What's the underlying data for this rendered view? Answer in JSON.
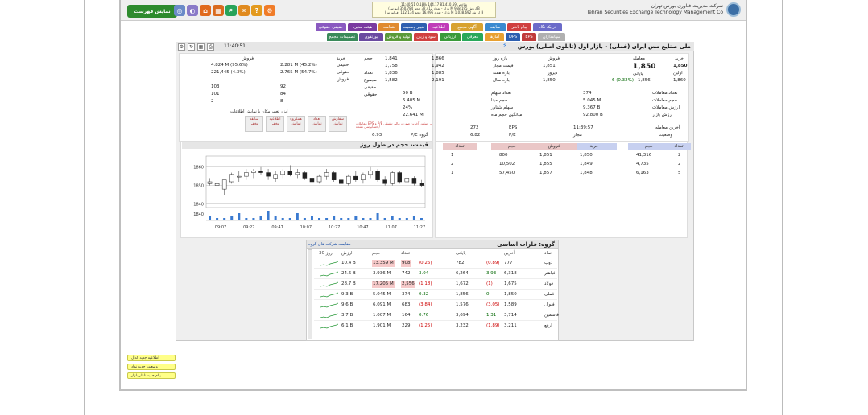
{
  "header": {
    "show_list_label": "نمایش فهرست",
    "brand_fa": "شرکت مدیریت فناوری بورس تهران",
    "brand_en": "Tehran Securities Exchange Technology Management Co",
    "index_lines": [
      "11:40:51 شاخص 81,410.59 144.17 %0.18",
      "(بورس) بازار - تعداد 32,412 حجم 350.784 M ارزش 958.195 B",
      "(فرابورس) بازار - تعداد 16,096 حجم 112.174 M ارزش 1,038.692 B"
    ],
    "icons": [
      {
        "name": "gear-icon",
        "color": "#f07c28"
      },
      {
        "name": "help-icon",
        "color": "#e39a1e"
      },
      {
        "name": "chat-icon",
        "color": "#e08a1e"
      },
      {
        "name": "search-icon",
        "color": "#27a35a"
      },
      {
        "name": "calc-icon",
        "color": "#d96a1e"
      },
      {
        "name": "home-icon",
        "color": "#e06a1e"
      },
      {
        "name": "contrast-icon",
        "color": "#8a7ac8"
      },
      {
        "name": "globe-icon",
        "color": "#6a8ac8"
      }
    ]
  },
  "tabs_row1": [
    {
      "label": "در یک نگاه",
      "color": "#6b6bc9"
    },
    {
      "label": "پیام ناظر",
      "color": "#d04040"
    },
    {
      "label": "سابقه",
      "color": "#3a8ad0"
    },
    {
      "label": "آگهی مجمع",
      "color": "#d8a230"
    },
    {
      "label": "اطلاعیه",
      "color": "#c03bb8"
    },
    {
      "label": "تغییر وضعیت",
      "color": "#2f5fb0"
    },
    {
      "label": "شناسه",
      "color": "#e08a30"
    },
    {
      "label": "هیئت مدیره",
      "color": "#7a3aa0"
    },
    {
      "label": "حقیقی-حقوقی",
      "color": "#8a5ac0"
    }
  ],
  "tabs_row2": [
    {
      "label": "سهامداران",
      "color": "#b0b0b0"
    },
    {
      "label": "EPS",
      "color": "#c03b3b"
    },
    {
      "label": "DPS",
      "color": "#2d5fb0"
    },
    {
      "label": "آمارها",
      "color": "#e8a030"
    },
    {
      "label": "معرفی",
      "color": "#28a85a"
    },
    {
      "label": "ارزیابی",
      "color": "#3a9a3a"
    },
    {
      "label": "سود و زیان",
      "color": "#d04040"
    },
    {
      "label": "تولید و فروش",
      "color": "#5a9a3a"
    },
    {
      "label": "پورتفوی",
      "color": "#6a4aa0"
    },
    {
      "label": "تصمیمات مجمع",
      "color": "#3a8a5a"
    }
  ],
  "title": {
    "text": "ملی صنایع مس ایران (فملی) - بازار اول (تابلوی اصلی) بورس",
    "time": "11:40:51"
  },
  "price_panel": {
    "rows": [
      {
        "l1": "معامله",
        "v1": "",
        "l2": "فروش",
        "v2": "1,851",
        "l3": "خرید",
        "v3": "1,850"
      },
      {
        "l1": "",
        "v1": "1,850",
        "l2": "قیمت مجاز",
        "v2": "",
        "l3": "",
        "v3": ""
      },
      {
        "l1": "پایانی",
        "v1": "1,856",
        "l2": "دیروز",
        "v2": "1,850",
        "l3": "اولین",
        "v3": "1,860"
      }
    ],
    "final_change": "6 (0.32%)",
    "range": [
      {
        "label": "بازه روز",
        "a": "1,866",
        "b": "1,841"
      },
      {
        "label": "قیمت مجاز",
        "a": "1,942",
        "b": "1,758"
      },
      {
        "label": "بازه هفته",
        "a": "1,885",
        "b": "1,836"
      },
      {
        "label": "بازه سال",
        "a": "2,191",
        "b": "1,582"
      }
    ],
    "stats": [
      {
        "label": "تعداد معاملات",
        "value": "374"
      },
      {
        "label": "حجم معاملات",
        "value": "5.045 M"
      },
      {
        "label": "ارزش معاملات",
        "value": "9.367 B"
      },
      {
        "label": "ارزش بازار",
        "value": "92,800 B"
      }
    ],
    "stats2": [
      {
        "label": "تعداد سهام",
        "value": "50 B"
      },
      {
        "label": "حجم مبنا",
        "value": "5.405 M"
      },
      {
        "label": "سهام شناور",
        "value": "24%"
      },
      {
        "label": "میانگین حجم ماه",
        "value": "22.641 M"
      }
    ],
    "last_trade": {
      "label": "آخرین معامله",
      "value": "11:39:57"
    },
    "status": {
      "label": "وضعیت",
      "value": "مجاز"
    },
    "eps": {
      "label": "EPS",
      "value": "272"
    },
    "pe": {
      "label": "P/E",
      "value": "6.82"
    },
    "group_pe": {
      "label": "P/E گروه",
      "value": "6.93"
    },
    "warning": "معاملات EPS و P/E بر اساس آخرین صورت مالی تلفیقی / حسابرسی نشده"
  },
  "realleg": {
    "headers": [
      "خرید",
      "فروش"
    ],
    "rows": [
      {
        "label": "حجم",
        "buy": "2.281 M (45.2%)",
        "sell": "4.824 M (95.6%)",
        "t": "حقیقی"
      },
      {
        "label": "",
        "buy": "2.765 M (54.7%)",
        "sell": "221,445 (4.3%)",
        "t": "حقوقی"
      },
      {
        "label": "تعداد",
        "buy": "",
        "sell": "",
        "t": "فروش"
      },
      {
        "label": "مجموع",
        "buy": "92",
        "sell": "103",
        "t": ""
      },
      {
        "label": "حقیقی",
        "buy": "84",
        "sell": "101",
        "t": ""
      },
      {
        "label": "حقوقی",
        "buy": "8",
        "sell": "2",
        "t": ""
      }
    ],
    "note": "ابزار تغییر مکان یا نمایش اطلاعات",
    "buttons": [
      "سفارش نمایش",
      "تعداد نمایش",
      "همگروه نمایش",
      "اطلاعیه مخفی",
      "سابقه مخفی"
    ]
  },
  "orderbook": {
    "headers": [
      "تعداد",
      "حجم",
      "خرید",
      "فروش",
      "حجم",
      "تعداد"
    ],
    "rows": [
      {
        "c1": "2",
        "v1": "41,316",
        "p1": "1,850",
        "p2": "1,851",
        "v2": "800",
        "c2": "1"
      },
      {
        "c1": "2",
        "v1": "4,735",
        "p1": "1,849",
        "p2": "1,855",
        "v2": "10,502",
        "c2": "2"
      },
      {
        "c1": "5",
        "v1": "6,163",
        "p1": "1,848",
        "p2": "1,857",
        "v2": "57,450",
        "c2": "1"
      }
    ]
  },
  "chart_data": {
    "type": "candlestick",
    "title": "قیمت، حجم در طول روز",
    "x_ticks": [
      "09:07",
      "09:27",
      "09:47",
      "10:07",
      "10:27",
      "10:47",
      "11:07",
      "11:27"
    ],
    "y_ticks": [
      1860,
      1850,
      1840
    ],
    "ylim": [
      1838,
      1866
    ],
    "candles": [
      [
        1851,
        1854,
        1850,
        1852
      ],
      [
        1850,
        1849,
        1846,
        1851
      ],
      [
        1848,
        1853,
        1845,
        1853
      ],
      [
        1852,
        1857,
        1851,
        1856
      ],
      [
        1855,
        1858,
        1852,
        1855
      ],
      [
        1855,
        1859,
        1853,
        1857
      ],
      [
        1857,
        1859,
        1854,
        1858
      ],
      [
        1858,
        1860,
        1856,
        1857
      ],
      [
        1857,
        1859,
        1853,
        1855
      ],
      [
        1854,
        1858,
        1852,
        1856
      ],
      [
        1856,
        1859,
        1854,
        1858
      ],
      [
        1858,
        1861,
        1855,
        1856
      ],
      [
        1856,
        1859,
        1854,
        1857
      ],
      [
        1857,
        1858,
        1853,
        1854
      ],
      [
        1854,
        1856,
        1850,
        1852
      ],
      [
        1852,
        1856,
        1851,
        1855
      ],
      [
        1855,
        1859,
        1853,
        1857
      ],
      [
        1857,
        1858,
        1852,
        1853
      ],
      [
        1853,
        1855,
        1849,
        1851
      ],
      [
        1851,
        1856,
        1850,
        1855
      ],
      [
        1855,
        1858,
        1852,
        1853
      ],
      [
        1853,
        1857,
        1851,
        1856
      ],
      [
        1856,
        1860,
        1854,
        1858
      ],
      [
        1858,
        1859,
        1852,
        1853
      ],
      [
        1853,
        1855,
        1850,
        1851
      ],
      [
        1851,
        1858,
        1850,
        1857
      ],
      [
        1857,
        1858,
        1851,
        1852
      ],
      [
        1852,
        1856,
        1850,
        1854
      ],
      [
        1854,
        1855,
        1850,
        1851
      ],
      [
        1851,
        1853,
        1849,
        1850
      ]
    ],
    "volumes": [
      2,
      1,
      1,
      2,
      3,
      1,
      1,
      2,
      4,
      2,
      1,
      1,
      3,
      1,
      2,
      1,
      1,
      2,
      1,
      1,
      2,
      1,
      1,
      3,
      1,
      2,
      1,
      1,
      2,
      1
    ]
  },
  "group": {
    "title": "گروه: فلزات اساسی",
    "link": "مقایسه شرکت های گروه",
    "headers": [
      "نماد",
      "آخرین",
      "پایانی",
      "",
      "تعداد",
      "حجم",
      "ارزش",
      "30 روز"
    ],
    "rows": [
      {
        "sym": "ذوب",
        "last": "777",
        "lch": "(0.89)",
        "close": "782",
        "cch": "(0.26)",
        "cnt": "908",
        "vol": "13.359 M",
        "val": "10.4 B",
        "hl": true
      },
      {
        "sym": "فباهنر",
        "last": "6,318",
        "lch": "3.93",
        "close": "6,264",
        "cch": "3.04",
        "cnt": "742",
        "vol": "3.936 M",
        "val": "24.6 B",
        "hl": false
      },
      {
        "sym": "فولاد",
        "last": "1,675",
        "lch": "(1)",
        "close": "1,672",
        "cch": "(1.18)",
        "cnt": "2,556",
        "vol": "17.205 M",
        "val": "28.7 B",
        "hl": true
      },
      {
        "sym": "فملی",
        "last": "1,850",
        "lch": "0",
        "close": "1,856",
        "cch": "0.32",
        "cnt": "374",
        "vol": "5.045 M",
        "val": "9.3 B",
        "hl": false
      },
      {
        "sym": "فنوال",
        "last": "1,589",
        "lch": "(3.05)",
        "close": "1,576",
        "cch": "(3.84)",
        "cnt": "683",
        "vol": "6.091 M",
        "val": "9.6 B",
        "hl": false
      },
      {
        "sym": "فاسمین",
        "last": "3,714",
        "lch": "1.31",
        "close": "3,694",
        "cch": "0.76",
        "cnt": "164",
        "vol": "1.007 M",
        "val": "3.7 B",
        "hl": false
      },
      {
        "sym": "ارفع",
        "last": "3,211",
        "lch": "(1.89)",
        "close": "3,232",
        "cch": "(1.25)",
        "cnt": "229",
        "vol": "1.901 M",
        "val": "6.1 B",
        "hl": false
      }
    ]
  },
  "notes": [
    "اطلاعیه جدید کدال",
    "وضعیت جدید نماد",
    "پیام جدید ناظر بازار"
  ]
}
